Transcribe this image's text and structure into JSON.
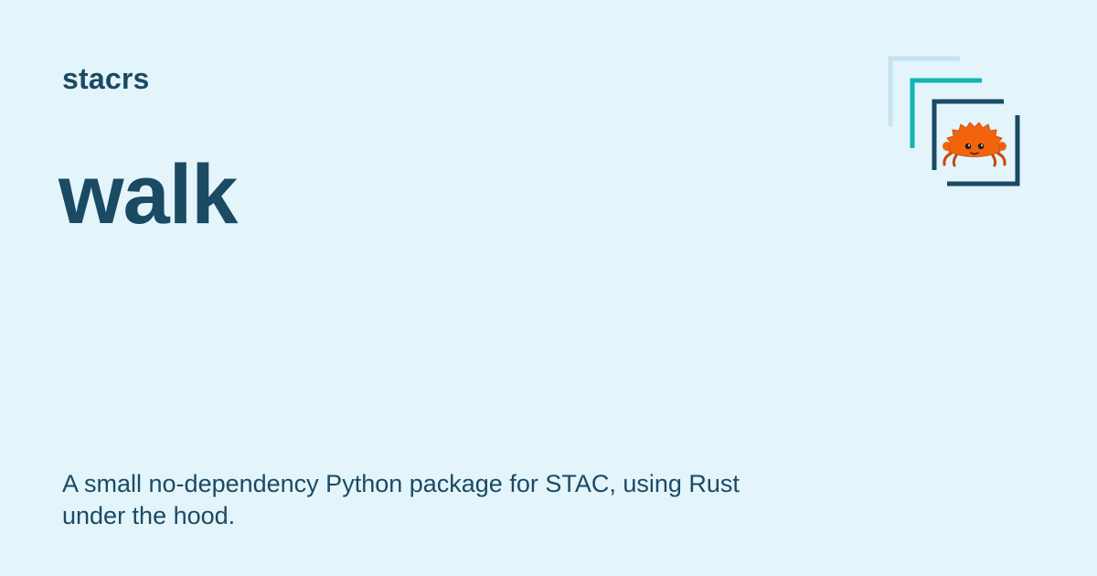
{
  "site": {
    "name": "stacrs"
  },
  "page": {
    "title": "walk",
    "description": "A small no-dependency Python package for STAC, using Rust under the hood."
  },
  "logo": {
    "icon": "stacrs-logo-icon",
    "mascot": "ferris-crab-icon"
  },
  "colors": {
    "background": "#e3f4fb",
    "text": "#1b4a63",
    "frame_light": "#c5e3f2",
    "frame_teal": "#12b4b4",
    "frame_dark": "#1b4a63",
    "crab": "#f2640c"
  }
}
